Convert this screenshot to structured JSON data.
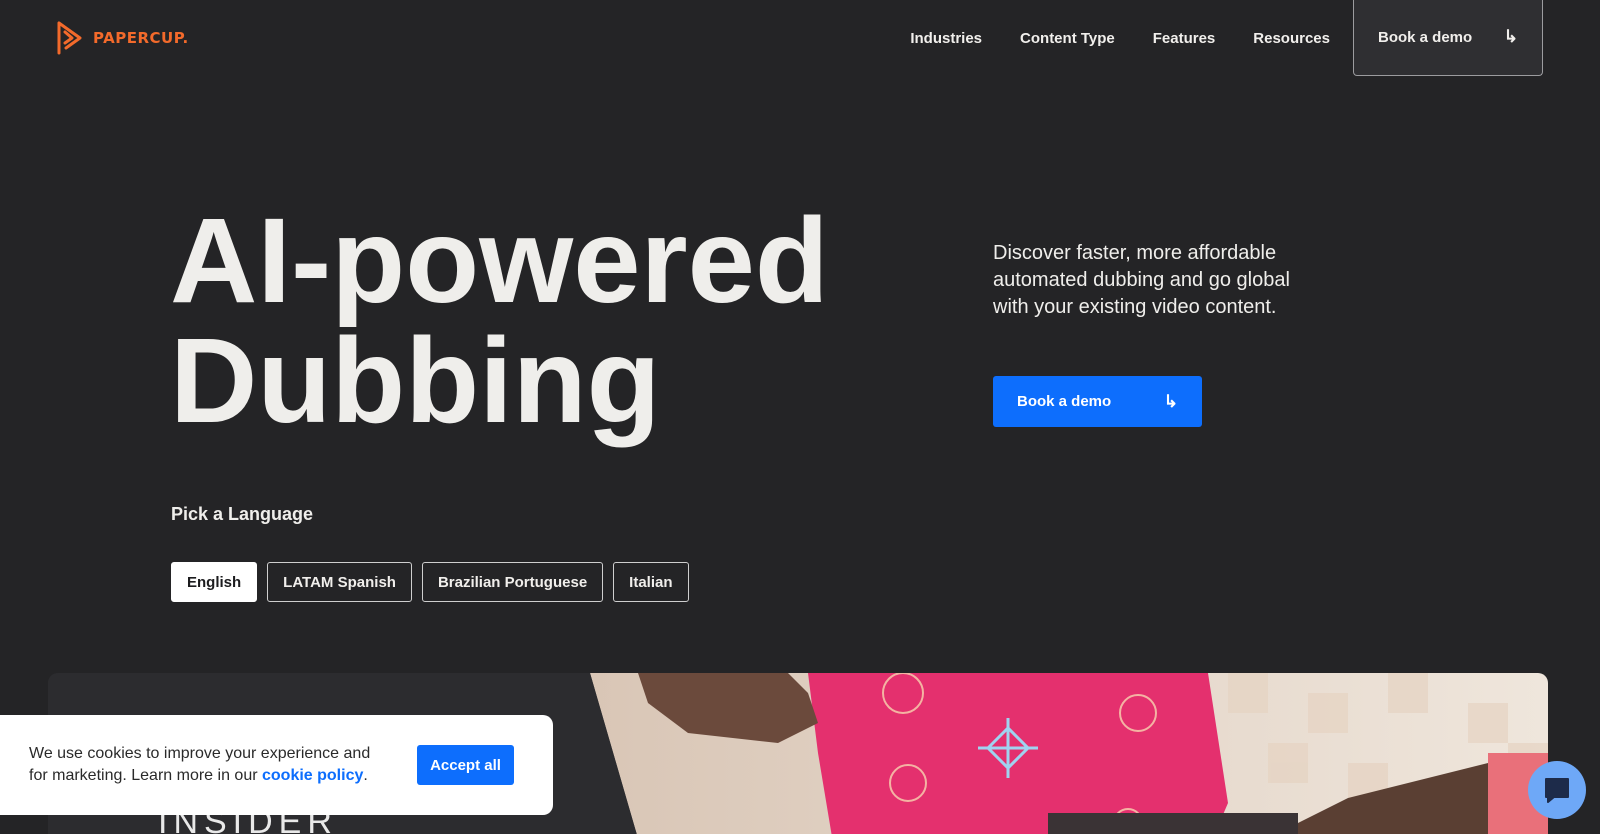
{
  "brand": {
    "name": "PAPERCUP.",
    "accent": "#f36a2b"
  },
  "nav": {
    "items": [
      {
        "label": "Industries"
      },
      {
        "label": "Content Type"
      },
      {
        "label": "Features"
      },
      {
        "label": "Resources"
      }
    ],
    "cta_label": "Book a demo",
    "cta_icon": "arrow-turn-down-right-icon"
  },
  "hero": {
    "title_line1": "AI-powered",
    "title_line2": "Dubbing",
    "description": "Discover faster, more affordable automated dubbing and go global with your existing video content.",
    "cta_label": "Book a demo",
    "cta_color": "#0d6efd"
  },
  "languages": {
    "label": "Pick a Language",
    "options": [
      {
        "label": "English",
        "selected": true
      },
      {
        "label": "LATAM Spanish",
        "selected": false
      },
      {
        "label": "Brazilian Portuguese",
        "selected": false
      },
      {
        "label": "Italian",
        "selected": false
      }
    ]
  },
  "video": {
    "brand_overlay": "INSIDER"
  },
  "cookie": {
    "text_before": "We use cookies to improve your experience and for marketing. Learn more in our ",
    "link_text": "cookie policy",
    "text_after": ".",
    "accept_label": "Accept all"
  },
  "chat": {
    "icon": "chat-bubble-icon",
    "color": "#6ea8f7"
  }
}
